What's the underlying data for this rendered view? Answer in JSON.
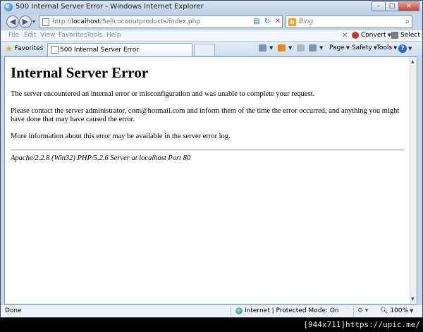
{
  "window": {
    "title": "500 Internal Server Error - Windows Internet Explorer",
    "buttons": {
      "minimize": "–",
      "maximize": "□",
      "close": "✕"
    }
  },
  "address_bar": {
    "url_prefix": "http://",
    "url_host": "localhost",
    "url_path": "/Sellcoconutproducts/index.php",
    "search_placeholder": "Bing"
  },
  "menu": {
    "items": [
      "File",
      "Edit",
      "View",
      "Favorites",
      "Tools",
      "Help"
    ],
    "convert_label": "Convert",
    "select_label": "Select"
  },
  "tabs": {
    "favorites_label": "Favorites",
    "active_tab_label": "500 Internal Server Error"
  },
  "command_bar": {
    "page_label": "Page",
    "safety_label": "Safety",
    "tools_label": "Tools",
    "help_label": "?"
  },
  "content": {
    "heading": "Internal Server Error",
    "p1": "The server encountered an internal error or misconfiguration and was unable to complete your request.",
    "p2": "Please contact the server administrator, com@hotmail.com and inform them of the time the error occurred, and anything you might have done that may have caused the error.",
    "p3": "More information about this error may be available in the server error log.",
    "server_signature": "Apache/2.2.8 (Win32) PHP/5.2.6 Server at localhost Port 80"
  },
  "status_bar": {
    "status": "Done",
    "zone": "Internet | Protected Mode: On",
    "zoom": "100%"
  },
  "watermark": "[944x711]https://upic.me/",
  "colors": {
    "frame": "#c5d6ea",
    "close_button": "#c8462e",
    "link_blue": "#1f5fb0"
  }
}
